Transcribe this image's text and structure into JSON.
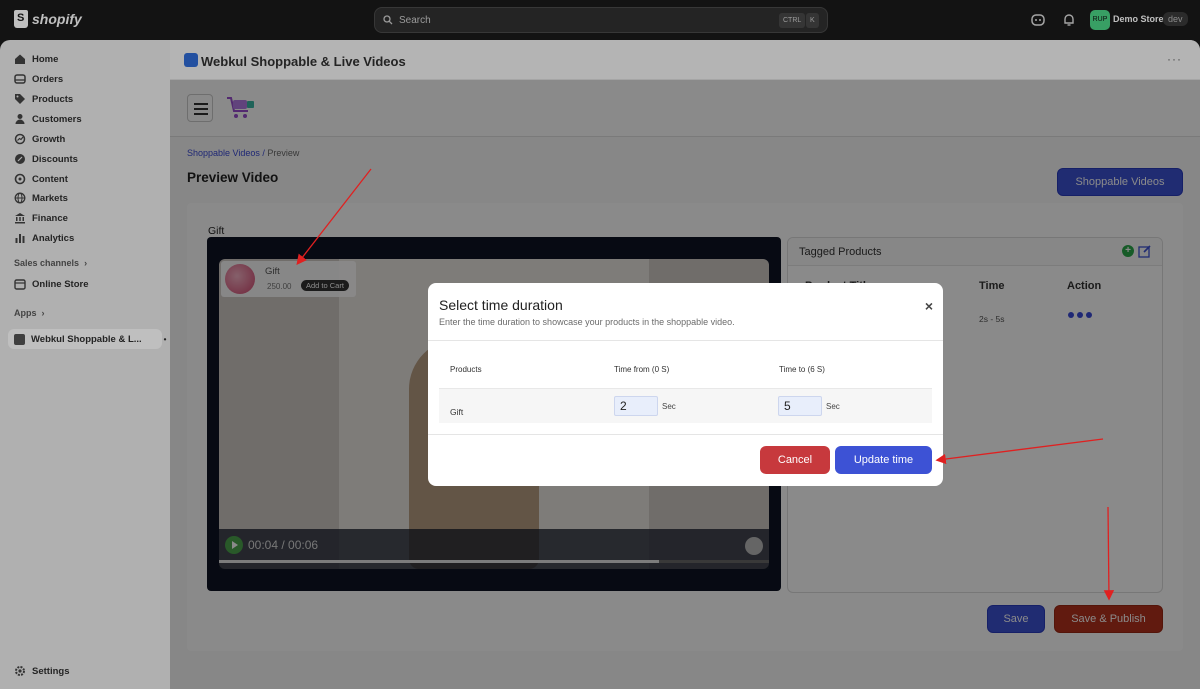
{
  "topbar": {
    "logo_text": "shopify",
    "search_placeholder": "Search",
    "shortcut_ctrl": "CTRL",
    "shortcut_key": "K",
    "avatar_initials": "RUP",
    "store_name": "Demo Store",
    "store_badge": "dev"
  },
  "sidebar": {
    "items": [
      {
        "label": "Home",
        "icon": "home-icon"
      },
      {
        "label": "Orders",
        "icon": "inbox-icon"
      },
      {
        "label": "Products",
        "icon": "tag-icon"
      },
      {
        "label": "Customers",
        "icon": "person-icon"
      },
      {
        "label": "Growth",
        "icon": "growth-icon"
      },
      {
        "label": "Discounts",
        "icon": "discount-icon"
      },
      {
        "label": "Content",
        "icon": "content-icon"
      },
      {
        "label": "Markets",
        "icon": "globe-icon"
      },
      {
        "label": "Finance",
        "icon": "bank-icon"
      },
      {
        "label": "Analytics",
        "icon": "bar-chart-icon"
      }
    ],
    "sales_channels_label": "Sales channels",
    "online_store_label": "Online Store",
    "apps_label": "Apps",
    "active_app_label": "Webkul Shoppable & L...",
    "settings_label": "Settings"
  },
  "app": {
    "title": "Webkul Shoppable & Live Videos",
    "more_label": "···",
    "breadcrumb_link": "Shoppable Videos /",
    "breadcrumb_current": "Preview",
    "page_title": "Preview Video",
    "shoppable_videos_button": "Shoppable Videos",
    "card_label": "Gift",
    "video": {
      "product_name": "Gift",
      "product_price": "250.00",
      "add_to_cart_label": "Add to Cart",
      "time_display": "00:04 / 00:06",
      "progress_fraction": 0.8
    },
    "tagged": {
      "title": "Tagged Products",
      "columns": [
        "Product Title",
        "Time",
        "Action"
      ],
      "rows": [
        {
          "time": "2s - 5s"
        }
      ]
    },
    "save_button": "Save",
    "save_publish_button": "Save & Publish"
  },
  "modal": {
    "title": "Select time duration",
    "subtitle": "Enter the time duration to showcase your products in the shoppable video.",
    "close_label": "×",
    "columns": [
      "Products",
      "Time from (0 S)",
      "Time to (6 S)"
    ],
    "row": {
      "product": "Gift",
      "time_from": "2",
      "time_to": "5",
      "unit": "Sec"
    },
    "cancel_button": "Cancel",
    "update_button": "Update time"
  },
  "colors": {
    "primary": "#3d52d5",
    "danger": "#c7393d",
    "save_publish": "#b5301c",
    "annotation_arrow": "#e02020"
  }
}
